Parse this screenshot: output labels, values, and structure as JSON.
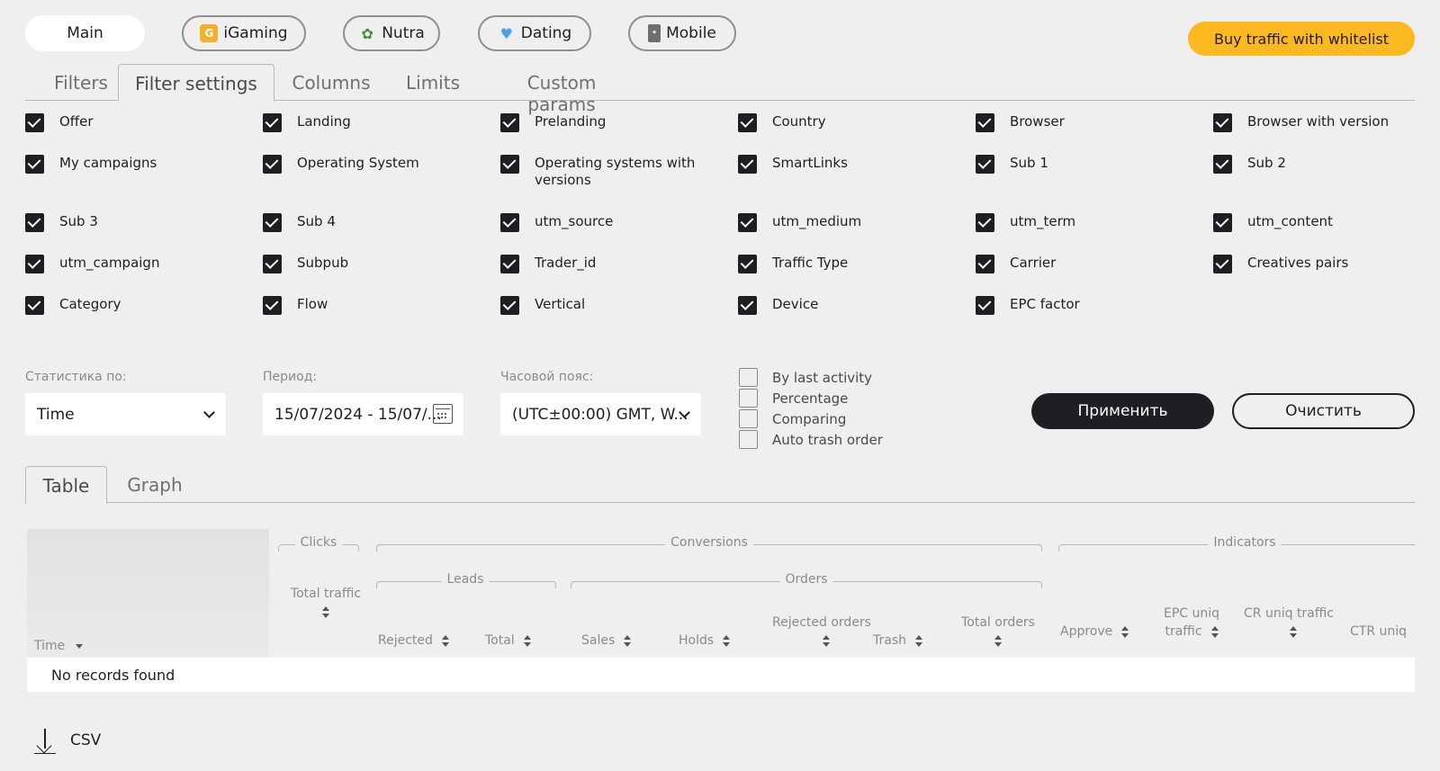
{
  "verticals": [
    {
      "label": "Main",
      "icon": ""
    },
    {
      "label": "iGaming",
      "icon": "igaming-icon"
    },
    {
      "label": "Nutra",
      "icon": "nutra-icon"
    },
    {
      "label": "Dating",
      "icon": "dating-icon"
    },
    {
      "label": "Mobile",
      "icon": "mobile-icon"
    }
  ],
  "buy_button": "Buy traffic with whitelist",
  "settings_tabs": [
    "Filters",
    "Filter settings",
    "Columns",
    "Limits",
    "Custom params"
  ],
  "checkboxes": [
    "Offer",
    "Landing",
    "Prelanding",
    "Country",
    "Browser",
    "Browser with version",
    "My campaigns",
    "Operating System",
    "Operating systems with versions",
    "SmartLinks",
    "Sub 1",
    "Sub 2",
    "Sub 3",
    "Sub 4",
    "utm_source",
    "utm_medium",
    "utm_term",
    "utm_content",
    "utm_campaign",
    "Subpub",
    "Trader_id",
    "Traffic Type",
    "Carrier",
    "Creatives pairs",
    "Category",
    "Flow",
    "Vertical",
    "Device",
    "EPC factor"
  ],
  "controls": {
    "stats_label": "Статистика по:",
    "stats_value": "Time",
    "period_label": "Период:",
    "period_value": "15/07/2024 - 15/07/...",
    "tz_label": "Часовой пояс:",
    "tz_value": "(UTC±00:00) GMT, W...",
    "options": [
      "By last activity",
      "Percentage",
      "Comparing",
      "Auto trash order"
    ],
    "apply": "Применить",
    "clear": "Очистить"
  },
  "view_tabs": [
    "Table",
    "Graph"
  ],
  "table": {
    "time": "Time",
    "groups": {
      "clicks": "Clicks",
      "conversions": "Conversions",
      "indicators": "Indicators",
      "leads": "Leads",
      "orders": "Orders"
    },
    "columns": {
      "total_traffic": "Total traffic",
      "rejected": "Rejected",
      "total": "Total",
      "sales": "Sales",
      "holds": "Holds",
      "rejected_orders": "Rejected orders",
      "trash": "Trash",
      "total_orders": "Total orders",
      "approve": "Approve",
      "epc_uniq": "EPC uniq traffic",
      "cr_uniq": "CR uniq traffic",
      "ctr_uniq": "CTR uniq"
    },
    "empty": "No records found"
  },
  "csv_label": "CSV"
}
